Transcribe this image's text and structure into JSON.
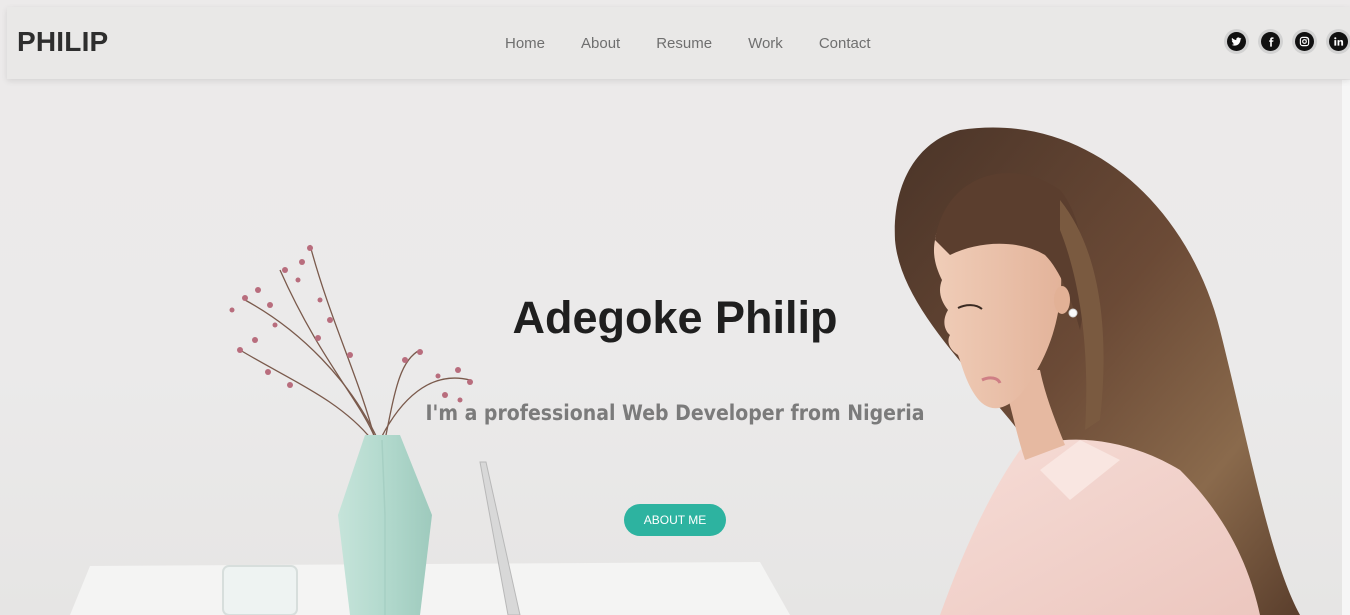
{
  "brand": "PHILIP",
  "nav": {
    "home": "Home",
    "about": "About",
    "resume": "Resume",
    "work": "Work",
    "contact": "Contact"
  },
  "socials": {
    "twitter": "twitter-icon",
    "facebook": "facebook-icon",
    "instagram": "instagram-icon",
    "linkedin": "linkedin-icon"
  },
  "hero": {
    "title": "Adegoke Philip",
    "subtitle": "I'm a professional Web Developer from Nigeria",
    "button_label": "ABOUT ME"
  },
  "colors": {
    "accent": "#2db3a0",
    "navbar_bg": "#e9e8e7",
    "text_dark": "#1f1f1f"
  }
}
